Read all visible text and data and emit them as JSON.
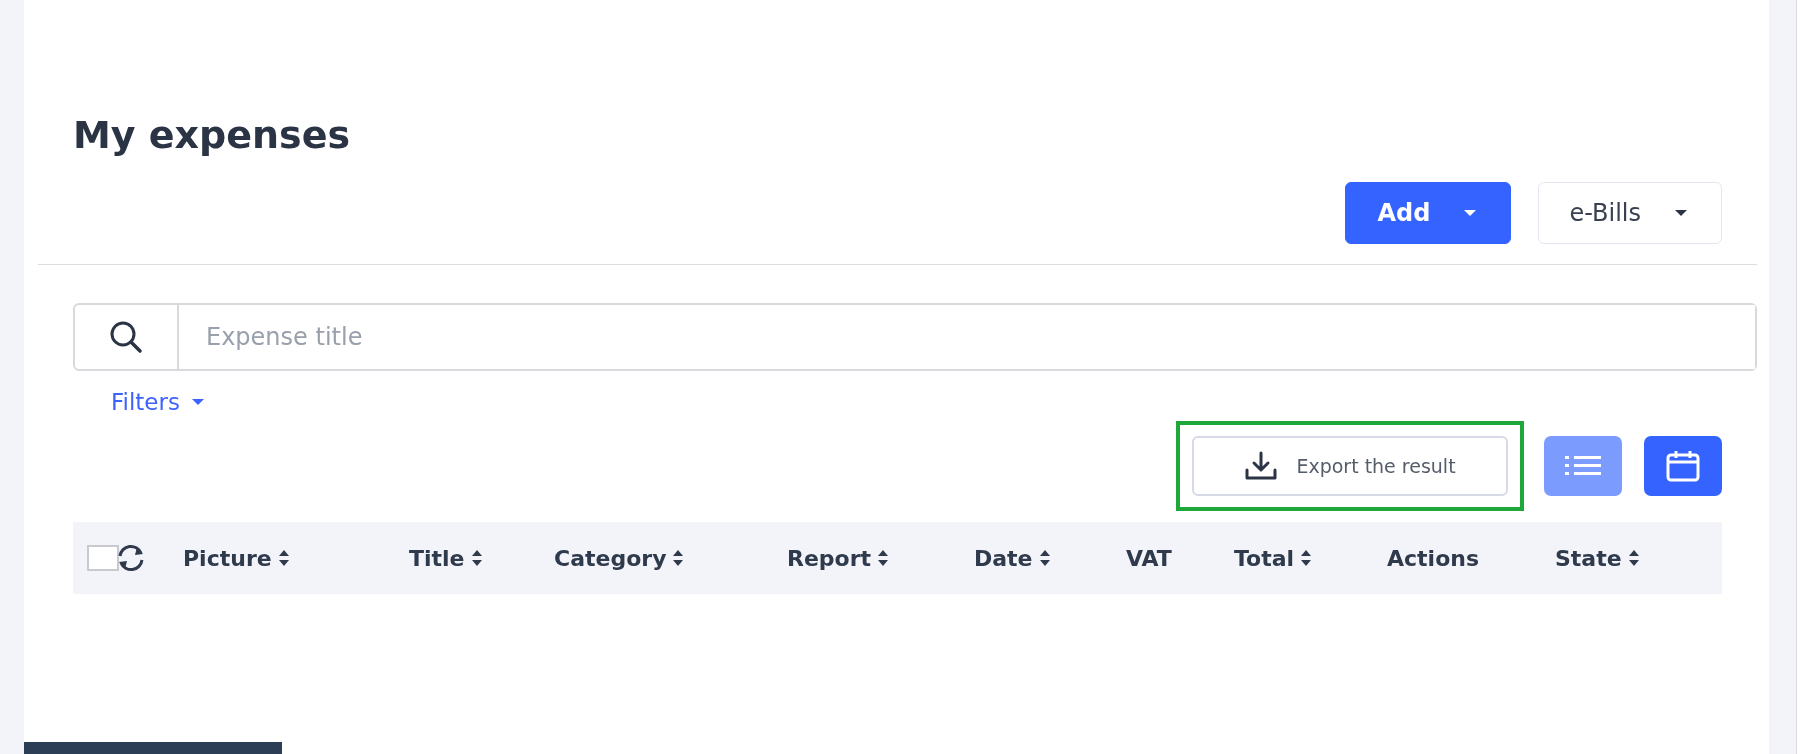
{
  "page": {
    "title": "My expenses"
  },
  "header_buttons": [
    {
      "label": "Add",
      "kind": "primary"
    },
    {
      "label": "e-Bills",
      "kind": "secondary"
    }
  ],
  "search": {
    "placeholder": "Expense title"
  },
  "filters": {
    "label": "Filters",
    "expanded": false
  },
  "export": {
    "label": "Export the result",
    "highlighted": true
  },
  "views": [
    {
      "kind": "list",
      "selected": false
    },
    {
      "kind": "calendar",
      "selected": true
    }
  ],
  "table": {
    "select_all": {
      "checked": false
    },
    "columns": [
      {
        "label": "Picture",
        "sortable": true
      },
      {
        "label": "Title",
        "sortable": true
      },
      {
        "label": "Category",
        "sortable": true
      },
      {
        "label": "Report",
        "sortable": true
      },
      {
        "label": "Date",
        "sortable": true
      },
      {
        "label": "VAT",
        "sortable": false
      },
      {
        "label": "Total",
        "sortable": true
      },
      {
        "label": "Actions",
        "sortable": false
      },
      {
        "label": "State",
        "sortable": true
      }
    ]
  }
}
